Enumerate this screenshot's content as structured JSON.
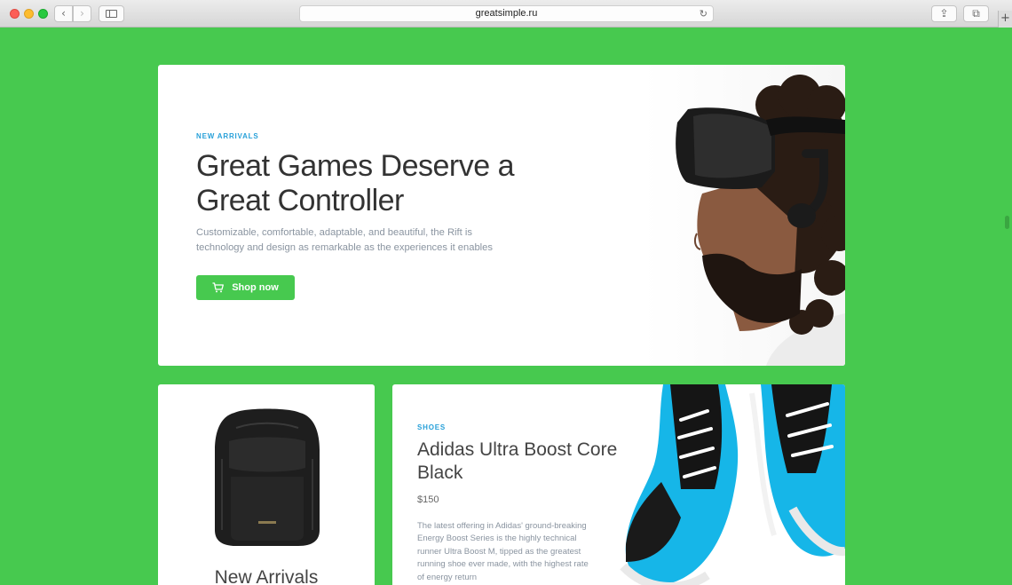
{
  "browser": {
    "url": "greatsimple.ru",
    "back_glyph": "‹",
    "forward_glyph": "›",
    "reload_glyph": "↻",
    "share_glyph": "⇪",
    "tabs_glyph": "⧉",
    "newtab_glyph": "+"
  },
  "hero": {
    "eyebrow": "NEW ARRIVALS",
    "title": "Great Games Deserve a Great Controller",
    "description": "Customizable, comfortable, adaptable, and beautiful, the Rift is technology and design as remarkable as the experiences it enables",
    "button_label": "Shop now",
    "button_icon": "cart-icon"
  },
  "category_card": {
    "title": "New Arrivals"
  },
  "product": {
    "eyebrow": "SHOES",
    "title": "Adidas Ultra Boost Core Black",
    "price": "$150",
    "description": "The latest offering in Adidas' ground-breaking Energy Boost Series is the highly technical runner Ultra Boost M, tipped as the greatest running shoe ever made, with the highest rate of energy return"
  },
  "colors": {
    "page_background": "#47c94f",
    "accent_green": "#47c94f",
    "eyebrow_blue": "#27a0d9"
  }
}
